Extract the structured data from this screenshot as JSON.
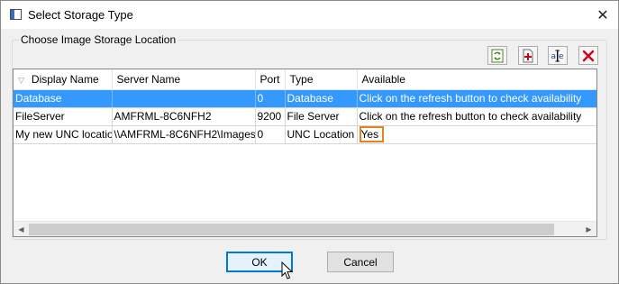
{
  "window": {
    "title": "Select Storage Type"
  },
  "group": {
    "label": "Choose Image Storage Location"
  },
  "toolbar": [
    {
      "name": "refresh-button",
      "icon": "refresh-icon"
    },
    {
      "name": "add-button",
      "icon": "add-document-icon"
    },
    {
      "name": "rename-button",
      "icon": "rename-icon"
    },
    {
      "name": "delete-button",
      "icon": "delete-icon"
    }
  ],
  "table": {
    "columns": [
      "Display Name",
      "Server Name",
      "Port",
      "Type",
      "Available"
    ],
    "rows": [
      {
        "display_name": "Database",
        "server_name": "",
        "port": "0",
        "type": "Database",
        "available": "Click on the refresh button to check availability",
        "selected": true
      },
      {
        "display_name": "FileServer",
        "server_name": "AMFRML-8C6NFH2",
        "port": "9200",
        "type": "File Server",
        "available": "Click on the refresh button to check availability",
        "selected": false
      },
      {
        "display_name": "My new UNC location",
        "server_name": "\\\\AMFRML-8C6NFH2\\Images",
        "port": "0",
        "type": "UNC Location",
        "available": "Yes",
        "selected": false
      }
    ]
  },
  "buttons": {
    "ok": "OK",
    "cancel": "Cancel"
  },
  "colors": {
    "selection": "#3399ff",
    "highlight": "#e8821e",
    "delete": "#d0021b"
  }
}
